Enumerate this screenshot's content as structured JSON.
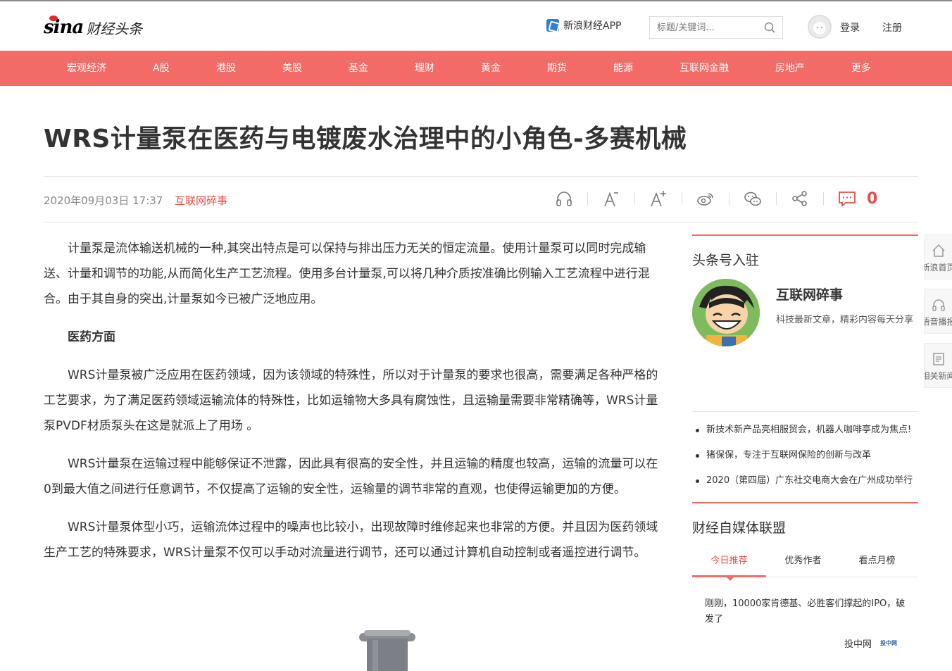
{
  "header": {
    "logo_brand": "sina",
    "logo_sub": "财经头条",
    "app_link": "新浪财经APP",
    "search_placeholder": "标题/关键词...",
    "login": "登录",
    "register": "注册"
  },
  "nav": {
    "items": [
      "宏观经济",
      "A股",
      "港股",
      "美股",
      "基金",
      "理财",
      "黄金",
      "期货",
      "能源",
      "互联网金融",
      "房地产",
      "更多"
    ]
  },
  "article": {
    "title": "WRS计量泵在医药与电镀废水治理中的小角色-多赛机械",
    "date": "2020年09月03日 17:37",
    "source": "互联网碎事",
    "comment_count": "0",
    "paragraphs": [
      "计量泵是流体输送机械的一种,其突出特点是可以保持与排出压力无关的恒定流量。使用计量泵可以同时完成输送、计量和调节的功能,从而简化生产工艺流程。使用多台计量泵,可以将几种介质按准确比例输入工艺流程中进行混合。由于其自身的突出,计量泵如今已被广泛地应用。",
      "医药方面",
      "WRS计量泵被广泛应用在医药领域，因为该领域的特殊性，所以对于计量泵的要求也很高，需要满足各种严格的工艺要求，为了满足医药领域运输流体的特殊性，比如运输物大多具有腐蚀性，且运输量需要非常精确等，WRS计量泵PVDF材质泵头在这是就派上了用场 。",
      "WRS计量泵在运输过程中能够保证不泄露，因此具有很高的安全性，并且运输的精度也较高，运输的流量可以在0到最大值之间进行任意调节，不仅提高了运输的安全性，运输量的调节非常的直观，也使得运输更加的方便。",
      "WRS计量泵体型小巧，运输流体过程中的噪声也比较小，出现故障时维修起来也非常的方便。并且因为医药领域生产工艺的特殊要求，WRS计量泵不仅可以手动对流量进行调节，还可以通过计算机自动控制或者遥控进行调节。"
    ]
  },
  "sidebar": {
    "section_title": "头条号入驻",
    "profile_name": "互联网碎事",
    "profile_desc": "科技最新文章，精彩内容每天分享",
    "news": [
      "新技术新产品亮相服贸会，机器人咖啡亭成为焦点!",
      "猪保保，专注于互联网保险的创新与改革",
      "2020（第四届）广东社交电商大会在广州成功举行"
    ],
    "union_title": "财经自媒体联盟",
    "tabs": [
      "今日推荐",
      "优秀作者",
      "看点月榜"
    ],
    "feed_text": "刚刚，10000家肯德基、必胜客们撑起的IPO，破发了",
    "feed_source": "投中网",
    "feed_source_logo": "投中网"
  },
  "float_bar": [
    "新浪首页",
    "语音播报",
    "相关新闻"
  ],
  "colors": {
    "accent": "#f36b66",
    "accent_text": "#e84c47"
  }
}
